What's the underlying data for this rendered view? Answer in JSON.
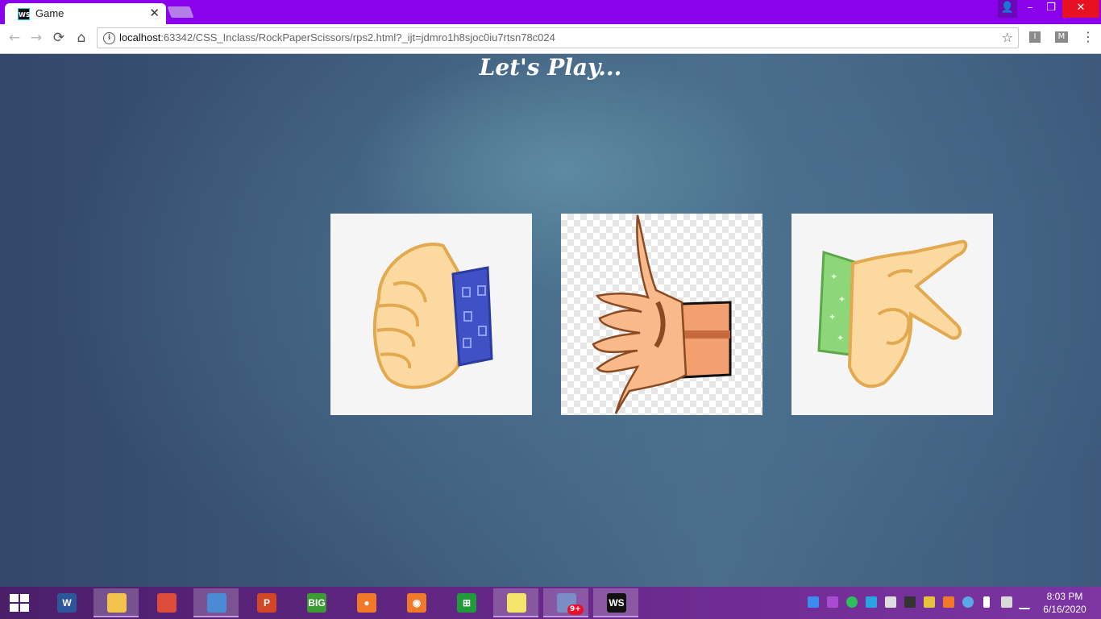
{
  "window": {
    "tab_title": "Game",
    "tab_favicon_text": "WS",
    "close_tab_glyph": "✕",
    "controls": {
      "minimize": "–",
      "restore": "❐",
      "close": "✕",
      "user": "👤"
    }
  },
  "toolbar": {
    "back_glyph": "←",
    "forward_glyph": "→",
    "reload_glyph": "⟳",
    "home_glyph": "⌂",
    "info_glyph": "i",
    "url_host": "localhost",
    "url_rest": ":63342/CSS_Inclass/RockPaperScissors/rps2.html?_ijt=jdmro1h8sjoc0iu7rtsn78c024",
    "star_glyph": "☆",
    "extension_1": "I",
    "extension_2": "M",
    "menu_glyph": "⋮"
  },
  "page": {
    "heading": "Let's Play...",
    "choices": [
      {
        "id": "rock",
        "icon": "rock-fist-hand"
      },
      {
        "id": "paper",
        "icon": "paper-open-hand"
      },
      {
        "id": "scissors",
        "icon": "scissors-v-hand"
      }
    ]
  },
  "taskbar": {
    "apps": [
      {
        "name": "word",
        "glyph": "W",
        "color": "#2b579a"
      },
      {
        "name": "file-explorer",
        "glyph": "",
        "color": "#f2c24a"
      },
      {
        "name": "chrome",
        "glyph": "",
        "color": "#dd4b39"
      },
      {
        "name": "chrome-canary",
        "glyph": "",
        "color": "#4b8bd6"
      },
      {
        "name": "powerpoint",
        "glyph": "P",
        "color": "#d24726"
      },
      {
        "name": "big-farm",
        "glyph": "BIG",
        "color": "#3d9b35"
      },
      {
        "name": "recorder",
        "glyph": "●",
        "color": "#f07a2a"
      },
      {
        "name": "camera",
        "glyph": "◉",
        "color": "#f07a2a"
      },
      {
        "name": "store",
        "glyph": "⊞",
        "color": "#1f9b3a"
      },
      {
        "name": "sticky-notes",
        "glyph": "",
        "color": "#f4e46a"
      },
      {
        "name": "messenger",
        "glyph": "",
        "color": "#7a8ec5"
      },
      {
        "name": "webstorm",
        "glyph": "WS",
        "color": "#111111"
      }
    ],
    "badge": "9+",
    "time": "8:03 PM",
    "date": "6/16/2020"
  }
}
